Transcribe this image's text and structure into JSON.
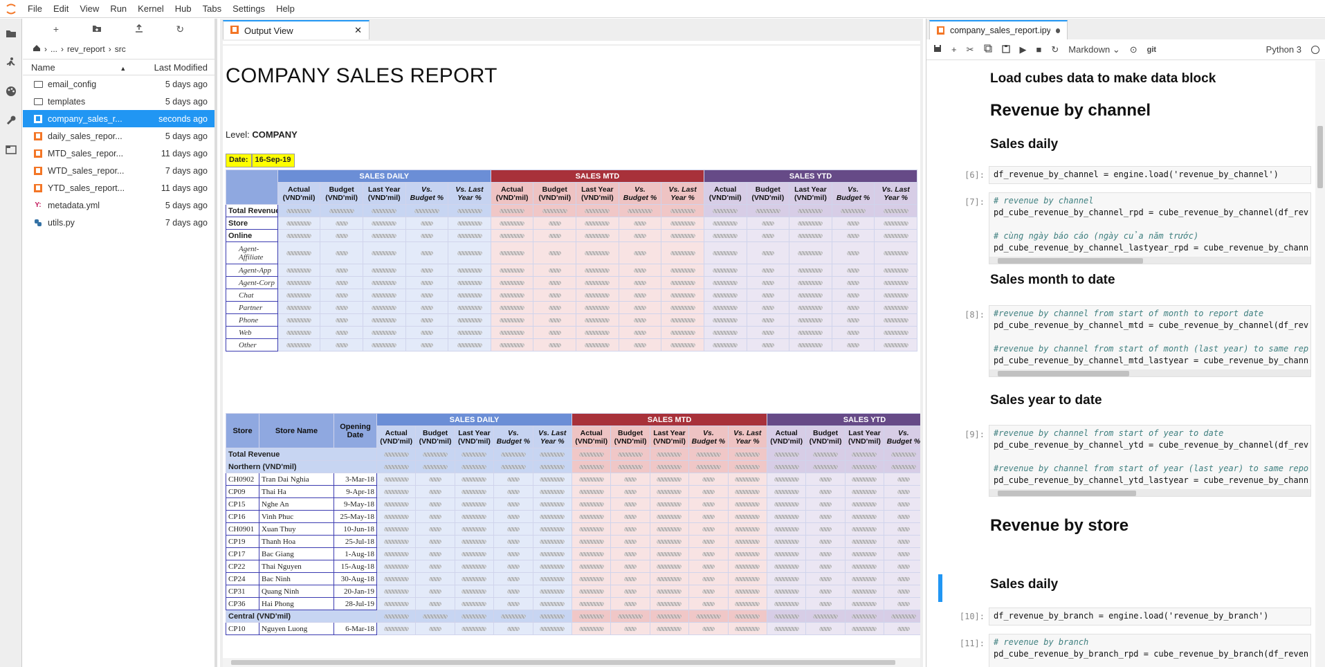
{
  "menu": [
    "File",
    "Edit",
    "View",
    "Run",
    "Kernel",
    "Hub",
    "Tabs",
    "Settings",
    "Help"
  ],
  "filebrowser": {
    "breadcrumb": [
      "...",
      "rev_report",
      "src"
    ],
    "header_name": "Name",
    "header_modified": "Last Modified",
    "files": [
      {
        "name": "email_config",
        "modified": "5 days ago",
        "type": "folder"
      },
      {
        "name": "templates",
        "modified": "5 days ago",
        "type": "folder"
      },
      {
        "name": "company_sales_r...",
        "modified": "seconds ago",
        "type": "notebook",
        "selected": true
      },
      {
        "name": "daily_sales_repor...",
        "modified": "5 days ago",
        "type": "notebook"
      },
      {
        "name": "MTD_sales_repor...",
        "modified": "11 days ago",
        "type": "notebook"
      },
      {
        "name": "WTD_sales_repor...",
        "modified": "7 days ago",
        "type": "notebook"
      },
      {
        "name": "YTD_sales_report...",
        "modified": "11 days ago",
        "type": "notebook"
      },
      {
        "name": "metadata.yml",
        "modified": "5 days ago",
        "type": "yaml"
      },
      {
        "name": "utils.py",
        "modified": "7 days ago",
        "type": "python"
      }
    ]
  },
  "output_tab": {
    "label": "Output View"
  },
  "report": {
    "title": "COMPANY SALES REPORT",
    "level_label": "Level:",
    "level_value": "COMPANY",
    "date_label": "Date:",
    "date_value": "16-Sep-19",
    "groups": [
      "SALES DAILY",
      "SALES MTD",
      "SALES YTD"
    ],
    "subheaders": [
      "Actual (VND'mil)",
      "Budget (VND'mil)",
      "Last Year (VND'mil)",
      "Vs. Budget %",
      "Vs. Last Year %"
    ],
    "channel_rows": [
      {
        "label": "Total Revenue",
        "style": "bold"
      },
      {
        "label": "Store",
        "style": "bold"
      },
      {
        "label": "Online",
        "style": "bold"
      },
      {
        "label": "Agent-Affiliate",
        "style": "italic"
      },
      {
        "label": "Agent-App",
        "style": "italic"
      },
      {
        "label": "Agent-Corp",
        "style": "italic"
      },
      {
        "label": "Chat",
        "style": "italic"
      },
      {
        "label": "Partner",
        "style": "italic"
      },
      {
        "label": "Phone",
        "style": "italic"
      },
      {
        "label": "Web",
        "style": "italic"
      },
      {
        "label": "Other",
        "style": "italic"
      }
    ],
    "store_headers": {
      "store": "Store",
      "name": "Store Name",
      "opening": "Opening Date"
    },
    "store_total": "Total Revenue",
    "region_northern": "Northern (VND'mil)",
    "region_central": "Central (VND'mil)",
    "stores": [
      {
        "code": "CH0902",
        "name": "Tran Dai Nghia",
        "date": "3-Mar-18"
      },
      {
        "code": "CP09",
        "name": "Thai Ha",
        "date": "9-Apr-18"
      },
      {
        "code": "CP15",
        "name": "Nghe An",
        "date": "9-May-18"
      },
      {
        "code": "CP16",
        "name": "Vinh Phuc",
        "date": "25-May-18"
      },
      {
        "code": "CH0901",
        "name": "Xuan Thuy",
        "date": "10-Jun-18"
      },
      {
        "code": "CP19",
        "name": "Thanh Hoa",
        "date": "25-Jul-18"
      },
      {
        "code": "CP17",
        "name": "Bac Giang",
        "date": "1-Aug-18"
      },
      {
        "code": "CP22",
        "name": "Thai Nguyen",
        "date": "15-Aug-18"
      },
      {
        "code": "CP24",
        "name": "Bac Ninh",
        "date": "30-Aug-18"
      },
      {
        "code": "CP31",
        "name": "Quang Ninh",
        "date": "20-Jan-19"
      },
      {
        "code": "CP36",
        "name": "Hai Phong",
        "date": "28-Jul-19"
      }
    ],
    "central_store": {
      "code": "CP10",
      "name": "Nguyen Luong",
      "date": "6-Mar-18"
    }
  },
  "notebook": {
    "tab_label": "company_sales_report.ipynb",
    "cell_type": "Markdown",
    "git": "git",
    "kernel": "Python 3",
    "headings": {
      "load": "Load cubes data to make data block",
      "rev_channel": "Revenue by channel",
      "sales_daily": "Sales daily",
      "sales_mtd": "Sales month to date",
      "sales_ytd": "Sales year to date",
      "rev_store": "Revenue by store",
      "sales_daily2": "Sales daily"
    },
    "prompts": [
      "[6]:",
      "[7]:",
      "[8]:",
      "[9]:",
      "[10]:",
      "[11]:"
    ],
    "code": {
      "c6": "df_revenue_by_channel = engine.load('revenue_by_channel')",
      "c7_1": "# revenue by channel",
      "c7_2": "pd_cube_revenue_by_channel_rpd = cube_revenue_by_channel(df_rev",
      "c7_3": "# cùng ngày báo cáo (ngày của năm trước)",
      "c7_4": "pd_cube_revenue_by_channel_lastyear_rpd = cube_revenue_by_chann",
      "c8_1": "#revenue by channel from start of month to report date",
      "c8_2": "pd_cube_revenue_by_channel_mtd = cube_revenue_by_channel(df_rev",
      "c8_3": "#revenue by channel from start of month (last year) to same rep",
      "c8_4": "pd_cube_revenue_by_channel_mtd_lastyear = cube_revenue_by_chann",
      "c9_1": "#revenue by channel from start of year to date",
      "c9_2": "pd_cube_revenue_by_channel_ytd = cube_revenue_by_channel(df_rev",
      "c9_3": "#revenue by channel from start of year (last year) to same repo",
      "c9_4": "pd_cube_revenue_by_channel_ytd_lastyear = cube_revenue_by_chann",
      "c10": "df_revenue_by_branch = engine.load('revenue_by_branch')",
      "c11_1": "# revenue by branch",
      "c11_2": "pd_cube_revenue_by_branch_rpd = cube_revenue_by_branch(df_reven"
    }
  }
}
